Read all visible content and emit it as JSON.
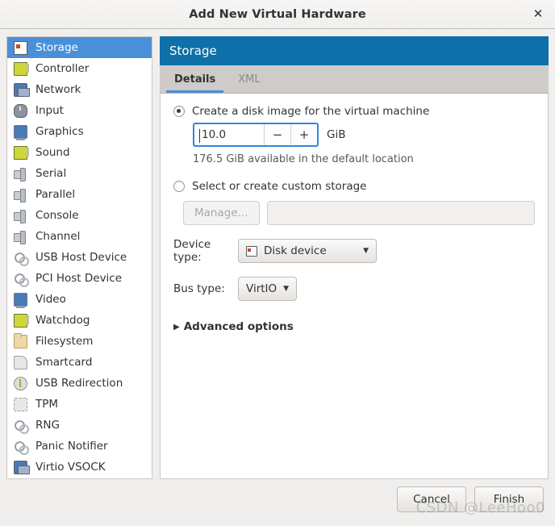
{
  "window": {
    "title": "Add New Virtual Hardware",
    "close_label": "✕"
  },
  "sidebar": {
    "items": [
      {
        "label": "Storage",
        "icon": "disk-icon",
        "selected": true
      },
      {
        "label": "Controller",
        "icon": "card-icon",
        "selected": false
      },
      {
        "label": "Network",
        "icon": "network-icon",
        "selected": false
      },
      {
        "label": "Input",
        "icon": "mouse-icon",
        "selected": false
      },
      {
        "label": "Graphics",
        "icon": "monitor-icon",
        "selected": false
      },
      {
        "label": "Sound",
        "icon": "card-icon",
        "selected": false
      },
      {
        "label": "Serial",
        "icon": "plug-icon",
        "selected": false
      },
      {
        "label": "Parallel",
        "icon": "plug-icon",
        "selected": false
      },
      {
        "label": "Console",
        "icon": "plug-icon",
        "selected": false
      },
      {
        "label": "Channel",
        "icon": "plug-icon",
        "selected": false
      },
      {
        "label": "USB Host Device",
        "icon": "gears-icon",
        "selected": false
      },
      {
        "label": "PCI Host Device",
        "icon": "gears-icon",
        "selected": false
      },
      {
        "label": "Video",
        "icon": "monitor-icon",
        "selected": false
      },
      {
        "label": "Watchdog",
        "icon": "card-icon",
        "selected": false
      },
      {
        "label": "Filesystem",
        "icon": "folder-icon",
        "selected": false
      },
      {
        "label": "Smartcard",
        "icon": "smartcard-icon",
        "selected": false
      },
      {
        "label": "USB Redirection",
        "icon": "usb-icon",
        "selected": false
      },
      {
        "label": "TPM",
        "icon": "chip-icon",
        "selected": false
      },
      {
        "label": "RNG",
        "icon": "gears-icon",
        "selected": false
      },
      {
        "label": "Panic Notifier",
        "icon": "gears-icon",
        "selected": false
      },
      {
        "label": "Virtio VSOCK",
        "icon": "network-icon",
        "selected": false
      }
    ]
  },
  "panel": {
    "header_title": "Storage",
    "tabs": [
      {
        "label": "Details",
        "active": true
      },
      {
        "label": "XML",
        "active": false
      }
    ],
    "create_disk": {
      "radio_label": "Create a disk image for the virtual machine",
      "selected": true,
      "size_value": "10.0",
      "minus_label": "−",
      "plus_label": "+",
      "unit": "GiB",
      "hint": "176.5 GiB available in the default location"
    },
    "custom_storage": {
      "radio_label": "Select or create custom storage",
      "selected": false,
      "manage_label": "Manage...",
      "path_value": ""
    },
    "device_type": {
      "label": "Device type:",
      "value": "Disk device",
      "icon": "disk-icon"
    },
    "bus_type": {
      "label": "Bus type:",
      "value": "VirtIO"
    },
    "advanced": {
      "label": "Advanced options",
      "triangle": "▶",
      "expanded": false
    }
  },
  "footer": {
    "cancel_label": "Cancel",
    "finish_label": "Finish"
  },
  "watermark": {
    "text": "CSDN @LeeHoo0"
  },
  "colors": {
    "header_blue": "#0f6fa8",
    "selection_blue": "#4a90d9",
    "focus_blue": "#3584e4",
    "window_bg": "#f0efee",
    "panel_bg": "#ffffff",
    "tabbar_bg": "#cecbc8"
  }
}
